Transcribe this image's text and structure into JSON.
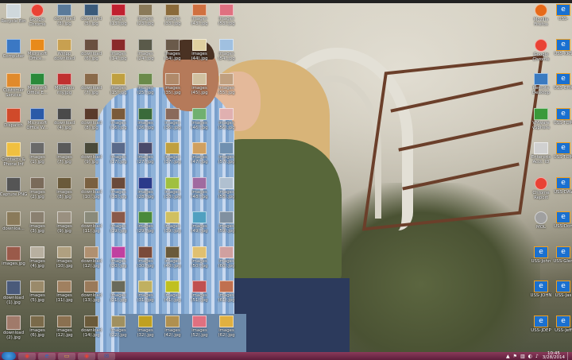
{
  "left_column": [
    {
      "label": "Recycle Bin",
      "icon": "recycle-bin-icon",
      "color": "#cfd8dc"
    },
    {
      "label": "Computer",
      "icon": "computer-icon",
      "color": "#3b78c4"
    },
    {
      "label": "Customer\nService",
      "icon": "customer-service-icon",
      "color": "#e08a2c"
    },
    {
      "label": "Dispatch",
      "icon": "dispatch-icon",
      "color": "#d04a2a"
    },
    {
      "label": "Contacts &\nPhone Inf",
      "icon": "contacts-icon",
      "color": "#f0c040"
    },
    {
      "label": "Capture.PNG",
      "icon": "image-file-icon",
      "color": "#555555"
    },
    {
      "label": "downloa...",
      "icon": "image-file-icon",
      "color": "#8a7a5a"
    },
    {
      "label": "images.jpg",
      "icon": "image-file-icon",
      "color": "#9a5a4a"
    },
    {
      "label": "download\n(1).jpg",
      "icon": "image-file-icon",
      "color": "#4a5a7a"
    },
    {
      "label": "download\n(2).jpg",
      "icon": "image-file-icon",
      "color": "#a07a6a"
    }
  ],
  "grid_columns": [
    [
      {
        "label": "Google\nChrome",
        "icon": "chrome-icon",
        "color": "#e94235"
      },
      {
        "label": "Microsoft\nOffice...",
        "icon": "office-icon",
        "color": "#e88a1a"
      },
      {
        "label": "Microsoft\nOffice E...",
        "icon": "excel-icon",
        "color": "#2a8a3a"
      },
      {
        "label": "Microsoft\nOffice W...",
        "icon": "word-icon",
        "color": "#2a5aa8"
      },
      {
        "label": "images\n(1).jpg",
        "icon": "image-file-icon",
        "color": "#6a6a6a"
      },
      {
        "label": "images\n(2).jpg",
        "icon": "image-file-icon",
        "color": "#7a6a5a"
      },
      {
        "label": "images\n(3).jpg",
        "icon": "image-file-icon",
        "color": "#8a8070"
      },
      {
        "label": "images\n(4).jpg",
        "icon": "image-file-icon",
        "color": "#b8b0a0"
      },
      {
        "label": "images\n(5).jpg",
        "icon": "image-file-icon",
        "color": "#9a8a6a"
      },
      {
        "label": "images\n(6).jpg",
        "icon": "image-file-icon",
        "color": "#7a6a4a"
      }
    ],
    [
      {
        "label": "download\n(3).jpg",
        "icon": "image-file-icon",
        "color": "#5a7a9a"
      },
      {
        "label": "Winpp\ndownload",
        "icon": "file-icon",
        "color": "#c8a050"
      },
      {
        "label": "ModSecu\nrity.jpg",
        "icon": "image-file-icon",
        "color": "#c03030"
      },
      {
        "label": "download\n(4).jpg",
        "icon": "image-file-icon",
        "color": "#4a4a4a"
      },
      {
        "label": "images\n(7).jpg",
        "icon": "image-file-icon",
        "color": "#5a5a5a"
      },
      {
        "label": "images\n(8).jpg",
        "icon": "image-file-icon",
        "color": "#6a5a3a"
      },
      {
        "label": "images\n(9).jpg",
        "icon": "image-file-icon",
        "color": "#9a9080"
      },
      {
        "label": "images\n(10).jpg",
        "icon": "image-file-icon",
        "color": "#b0a080"
      },
      {
        "label": "images\n(11).jpg",
        "icon": "image-file-icon",
        "color": "#a08060"
      },
      {
        "label": "images\n(12).jpg",
        "icon": "image-file-icon",
        "color": "#8a7050"
      }
    ],
    [
      {
        "label": "download\n(5).jpg",
        "icon": "image-file-icon",
        "color": "#3a5a7a"
      },
      {
        "label": "download\n(6).jpg",
        "icon": "image-file-icon",
        "color": "#6a5040"
      },
      {
        "label": "download\n(7).jpg",
        "icon": "image-file-icon",
        "color": "#8a6a4a"
      },
      {
        "label": "download\n(8).jpg",
        "icon": "image-file-icon",
        "color": "#5a3a2a"
      },
      {
        "label": "download\n(9).jpg",
        "icon": "image-file-icon",
        "color": "#4a4a3a"
      },
      {
        "label": "download\n(10).jpg",
        "icon": "image-file-icon",
        "color": "#7a6040"
      },
      {
        "label": "download\n(11).jpg",
        "icon": "image-file-icon",
        "color": "#8a8a7a"
      },
      {
        "label": "download\n(12).jpg",
        "icon": "image-file-icon",
        "color": "#b09070"
      },
      {
        "label": "download\n(13).jpg",
        "icon": "image-file-icon",
        "color": "#9a7a5a"
      },
      {
        "label": "download\n(14).jpg",
        "icon": "image-file-icon",
        "color": "#6a5a3a"
      }
    ],
    [
      {
        "label": "images\n(13).jpg",
        "icon": "image-file-icon",
        "color": "#c02030"
      },
      {
        "label": "images\n(14).jpg",
        "icon": "image-file-icon",
        "color": "#8a2a2a"
      },
      {
        "label": "images\n(15).jpg",
        "icon": "image-file-icon",
        "color": "#c0a040"
      },
      {
        "label": "images\n(16).jpg",
        "icon": "image-file-icon",
        "color": "#7a5a3a"
      },
      {
        "label": "images\n(17).jpg",
        "icon": "image-file-icon",
        "color": "#5a6a8a"
      },
      {
        "label": "images\n(18).jpg",
        "icon": "image-file-icon",
        "color": "#6a4a3a"
      },
      {
        "label": "images\n(19).jpg",
        "icon": "image-file-icon",
        "color": "#8a5a4a"
      },
      {
        "label": "images\n(20).jpg",
        "icon": "image-file-icon",
        "color": "#c040a0"
      },
      {
        "label": "images\n(21).jpg",
        "icon": "image-file-icon",
        "color": "#6a6a5a"
      },
      {
        "label": "images\n(22).jpg",
        "icon": "image-file-icon",
        "color": "#a09060"
      }
    ],
    [
      {
        "label": "images\n(23).jpg",
        "icon": "image-file-icon",
        "color": "#8a7a5a"
      },
      {
        "label": "images\n(24).jpg",
        "icon": "image-file-icon",
        "color": "#5a5a4a"
      },
      {
        "label": "images\n(25).jpg",
        "icon": "image-file-icon",
        "color": "#6a8a4a"
      },
      {
        "label": "images\n(26).jpg",
        "icon": "image-file-icon",
        "color": "#3a6a3a"
      },
      {
        "label": "images\n(27).jpg",
        "icon": "image-file-icon",
        "color": "#4a4a6a"
      },
      {
        "label": "images\n(28).jpg",
        "icon": "image-file-icon",
        "color": "#2a3a8a"
      },
      {
        "label": "images\n(29).jpg",
        "icon": "image-file-icon",
        "color": "#4a8a3a"
      },
      {
        "label": "images\n(30).jpg",
        "icon": "image-file-icon",
        "color": "#7a4a3a"
      },
      {
        "label": "images\n(31).jpg",
        "icon": "image-file-icon",
        "color": "#c0b060"
      },
      {
        "label": "images\n(32).jpg",
        "icon": "image-file-icon",
        "color": "#c0a020"
      }
    ],
    [
      {
        "label": "images\n(33).jpg",
        "icon": "image-file-icon",
        "color": "#8a6a3a"
      },
      {
        "label": "images\n(34).jpg",
        "icon": "image-file-icon",
        "color": "#6a5a4a"
      },
      {
        "label": "images\n(35).jpg",
        "icon": "image-file-icon",
        "color": "#b08a6a"
      },
      {
        "label": "images\n(36).jpg",
        "icon": "image-file-icon",
        "color": "#8a6a5a"
      },
      {
        "label": "images\n(37).jpg",
        "icon": "image-file-icon",
        "color": "#c0a040"
      },
      {
        "label": "images\n(38).jpg",
        "icon": "image-file-icon",
        "color": "#a0c040"
      },
      {
        "label": "images\n(39).jpg",
        "icon": "image-file-icon",
        "color": "#d0c060"
      },
      {
        "label": "images\n(40).jpg",
        "icon": "image-file-icon",
        "color": "#6a5a3a"
      },
      {
        "label": "images\n(41).jpg",
        "icon": "image-file-icon",
        "color": "#c0c020"
      },
      {
        "label": "images\n(42).jpg",
        "icon": "image-file-icon",
        "color": "#b09050"
      }
    ],
    [
      {
        "label": "images\n(43).jpg",
        "icon": "image-file-icon",
        "color": "#d07040"
      },
      {
        "label": "images\n(44).jpg",
        "icon": "image-file-icon",
        "color": "#e0d0a0"
      },
      {
        "label": "images\n(45).jpg",
        "icon": "image-file-icon",
        "color": "#d0c0a0"
      },
      {
        "label": "images\n(46).jpg",
        "icon": "image-file-icon",
        "color": "#70b070"
      },
      {
        "label": "images\n(47).jpg",
        "icon": "image-file-icon",
        "color": "#d0a060"
      },
      {
        "label": "images\n(48).jpg",
        "icon": "image-file-icon",
        "color": "#a06aa0"
      },
      {
        "label": "images\n(49).jpg",
        "icon": "image-file-icon",
        "color": "#50a0c0"
      },
      {
        "label": "images\n(50).jpg",
        "icon": "image-file-icon",
        "color": "#e0c070"
      },
      {
        "label": "images\n(51).jpg",
        "icon": "image-file-icon",
        "color": "#c05050"
      },
      {
        "label": "images\n(52).jpg",
        "icon": "image-file-icon",
        "color": "#e07080"
      }
    ],
    [
      {
        "label": "images\n(53).jpg",
        "icon": "image-file-icon",
        "color": "#e07080"
      },
      {
        "label": "images\n(54).jpg",
        "icon": "image-file-icon",
        "color": "#a0c0e0"
      },
      {
        "label": "images\n(55).jpg",
        "icon": "image-file-icon",
        "color": "#c0a080"
      },
      {
        "label": "images\n(56).jpg",
        "icon": "image-file-icon",
        "color": "#e0b0b0"
      },
      {
        "label": "images\n(57).jpg",
        "icon": "image-file-icon",
        "color": "#7090b0"
      },
      {
        "label": "images\n(58).jpg",
        "icon": "image-file-icon",
        "color": "#b0c0d0"
      },
      {
        "label": "images\n(59).jpg",
        "icon": "image-file-icon",
        "color": "#8090a0"
      },
      {
        "label": "images\n(60).jpg",
        "icon": "image-file-icon",
        "color": "#d0a0a0"
      },
      {
        "label": "images\n(61).jpg",
        "icon": "image-file-icon",
        "color": "#c07050"
      },
      {
        "label": "images\n(62).jpg",
        "icon": "image-file-icon",
        "color": "#e0b040"
      }
    ]
  ],
  "right_column_a": [
    {
      "label": "Mozilla\nFirefox",
      "icon": "firefox-icon",
      "color": "#e66a1a"
    },
    {
      "label": "Google\nChrome",
      "icon": "chrome-icon",
      "color": "#e94235"
    },
    {
      "label": "Remote\nDesktop",
      "icon": "remote-desktop-icon",
      "color": "#3a7ac0"
    },
    {
      "label": "VMware\nvSphere",
      "icon": "vmware-icon",
      "color": "#3a9a3a"
    },
    {
      "label": "Enterpris\nAcct. ID",
      "icon": "document-icon",
      "color": "#d0d0d0"
    },
    {
      "label": "Chrome\nReport",
      "icon": "chrome-report-icon",
      "color": "#e94235"
    },
    {
      "label": "MOL",
      "icon": "disc-icon",
      "color": "#a0a0a0"
    },
    {
      "label": "USS-John",
      "icon": "ie-shortcut-icon",
      "color": "#1a70d0"
    },
    {
      "label": "USS-JOHN",
      "icon": "ie-shortcut-icon",
      "color": "#1a70d0"
    },
    {
      "label": "USS-JDEP",
      "icon": "ie-shortcut-icon",
      "color": "#1a70d0"
    }
  ],
  "right_column_b": [
    {
      "label": "USS-",
      "icon": "ie-shortcut-icon",
      "color": "#1a70d0"
    },
    {
      "label": "USS-KRS",
      "icon": "ie-shortcut-icon",
      "color": "#1a70d0"
    },
    {
      "label": "USS-CHR",
      "icon": "ie-shortcut-icon",
      "color": "#1a70d0"
    },
    {
      "label": "USS-TOM",
      "icon": "ie-shortcut-icon",
      "color": "#1a70d0"
    },
    {
      "label": "USS-TOM",
      "icon": "ie-shortcut-icon",
      "color": "#1a70d0"
    },
    {
      "label": "USS-DAV",
      "icon": "ie-shortcut-icon",
      "color": "#1a70d0"
    },
    {
      "label": "USS-Don",
      "icon": "ie-shortcut-icon",
      "color": "#1a70d0"
    },
    {
      "label": "USS-Glen",
      "icon": "ie-shortcut-icon",
      "color": "#1a70d0"
    },
    {
      "label": "USS-Jas",
      "icon": "ie-shortcut-icon",
      "color": "#1a70d0"
    },
    {
      "label": "USS-Jeff",
      "icon": "ie-shortcut-icon",
      "color": "#1a70d0"
    }
  ],
  "taskbar": {
    "apps": [
      {
        "name": "chrome-taskbar-button",
        "glyph": "◉",
        "color": "#e94235"
      },
      {
        "name": "ie-taskbar-button",
        "glyph": "e",
        "color": "#1a70d0"
      },
      {
        "name": "explorer-taskbar-button",
        "glyph": "▭",
        "color": "#e0b040"
      },
      {
        "name": "chrome-window-taskbar-button",
        "glyph": "◉",
        "color": "#e94235"
      },
      {
        "name": "outlook-taskbar-button",
        "glyph": "✉",
        "color": "#2a5aa8"
      }
    ],
    "tray_icons": [
      "▲",
      "⚑",
      "▥",
      "◐",
      "♪"
    ],
    "clock_time": "10:45",
    "clock_date": "3/28/2014"
  }
}
